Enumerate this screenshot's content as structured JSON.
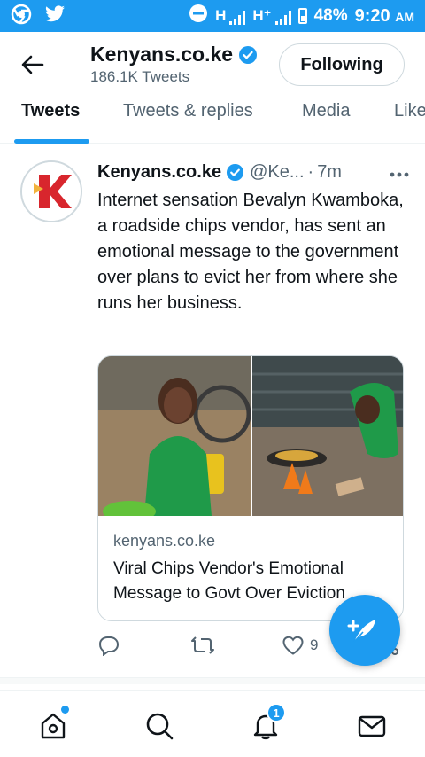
{
  "status_bar": {
    "network_primary": "H",
    "network_secondary": "H⁺",
    "battery": "48%",
    "time": "9:20",
    "time_suffix": "AM"
  },
  "header": {
    "name": "Kenyans.co.ke",
    "tweet_count": "186.1K Tweets",
    "follow_label": "Following"
  },
  "tabs": [
    {
      "label": "Tweets"
    },
    {
      "label": "Tweets & replies"
    },
    {
      "label": "Media"
    },
    {
      "label": "Like"
    }
  ],
  "tweet": {
    "author": "Kenyans.co.ke",
    "handle": "@Ke...",
    "separator": "·",
    "time": "7m",
    "text": "Internet sensation Bevalyn Kwamboka, a roadside chips vendor, has sent an emotional message to the government over plans to evict her from where she runs her business.",
    "card": {
      "domain": "kenyans.co.ke",
      "title": "Viral Chips Vendor's Emotional Message to Govt Over Eviction ..."
    },
    "like_count": "9"
  },
  "bottom_nav": {
    "notification_count": "1"
  },
  "colors": {
    "accent": "#1d9bf0",
    "text_primary": "#0f1419",
    "text_secondary": "#536471",
    "logo_red": "#d8262d"
  }
}
